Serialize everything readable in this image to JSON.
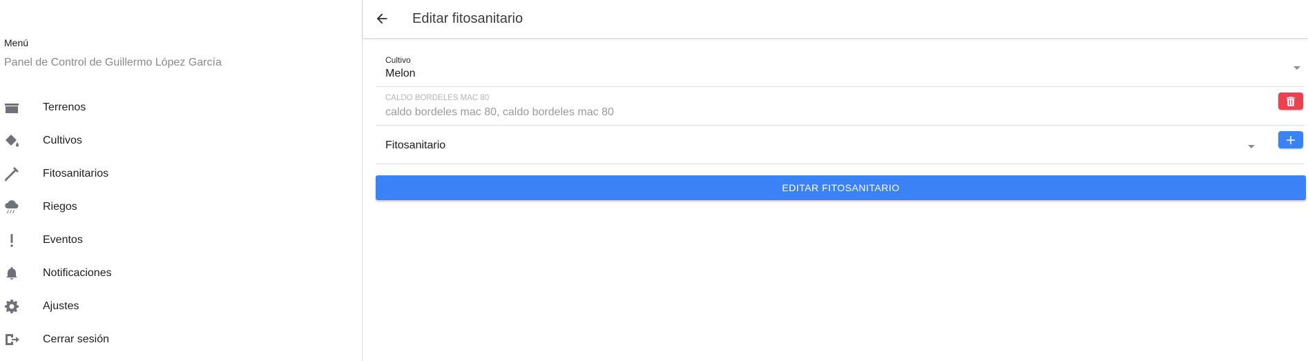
{
  "header": {
    "title": "Editar fitosanitario",
    "back_icon": "arrow-left-icon"
  },
  "sidebar": {
    "menu_label": "Menú",
    "subtitle": "Panel de Control de Guillermo López García",
    "items": [
      {
        "label": "Terrenos",
        "icon": "folder-icon"
      },
      {
        "label": "Cultivos",
        "icon": "paint-bucket-icon"
      },
      {
        "label": "Fitosanitarios",
        "icon": "syringe-icon"
      },
      {
        "label": "Riegos",
        "icon": "cloud-rain-icon"
      },
      {
        "label": "Eventos",
        "icon": "exclamation-icon"
      },
      {
        "label": "Notificaciones",
        "icon": "bell-icon"
      },
      {
        "label": "Ajustes",
        "icon": "gear-icon"
      },
      {
        "label": "Cerrar sesión",
        "icon": "sign-out-icon"
      }
    ]
  },
  "form": {
    "cultivo": {
      "label": "Cultivo",
      "value": "Melon"
    },
    "producto": {
      "label": "CALDO BORDELES MAC 80",
      "value": "caldo bordeles mac 80, caldo bordeles mac 80",
      "delete_icon": "trash-icon"
    },
    "fitosanitario": {
      "value": "Fitosanitario",
      "add_icon": "plus-icon"
    },
    "submit_label": "EDITAR FITOSANITARIO"
  },
  "colors": {
    "primary": "#3b82f6",
    "danger": "#e8434f",
    "icon_gray": "#6e7178"
  }
}
